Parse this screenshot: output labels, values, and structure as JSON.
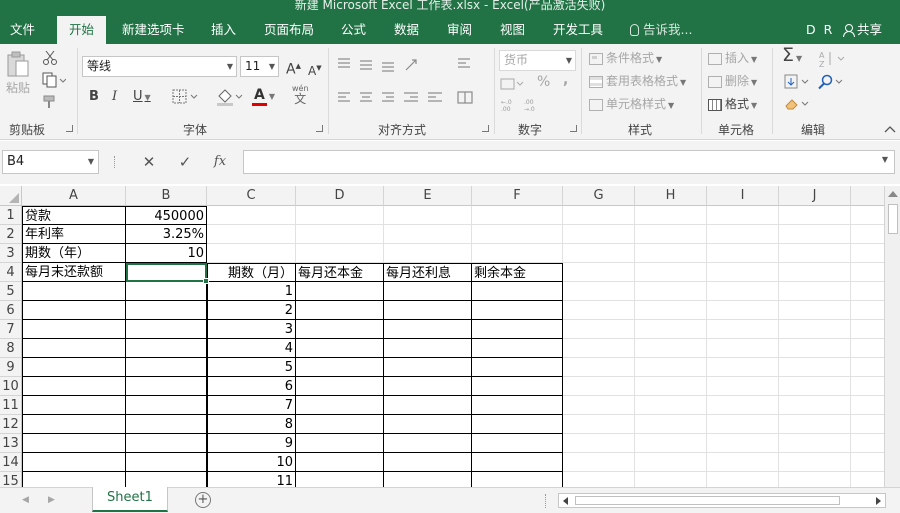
{
  "window": {
    "title": "新建 Microsoft Excel 工作表.xlsx - Excel(产品激活失败)"
  },
  "tabs": [
    {
      "label": "文件",
      "active": false
    },
    {
      "label": "开始",
      "active": true
    },
    {
      "label": "新建选项卡",
      "active": false
    },
    {
      "label": "插入",
      "active": false
    },
    {
      "label": "页面布局",
      "active": false
    },
    {
      "label": "公式",
      "active": false
    },
    {
      "label": "数据",
      "active": false
    },
    {
      "label": "审阅",
      "active": false
    },
    {
      "label": "视图",
      "active": false
    },
    {
      "label": "开发工具",
      "active": false
    }
  ],
  "tell_me": "告诉我...",
  "user_initials": "D R",
  "share_label": "共享",
  "ribbon": {
    "clipboard": {
      "label": "剪贴板",
      "paste": "粘贴"
    },
    "font": {
      "label": "字体",
      "font_name": "等线",
      "font_size": "11",
      "grow": "A",
      "shrink": "A",
      "bold": "B",
      "italic": "I",
      "underline": "U",
      "font_color": "A",
      "wen": "wén",
      "wen_char": "文"
    },
    "alignment": {
      "label": "对齐方式"
    },
    "number": {
      "label": "数字",
      "format": "货币",
      "percent": "%",
      "comma": ","
    },
    "styles": {
      "label": "样式",
      "conditional": "条件格式",
      "table": "套用表格格式",
      "cell_styles": "单元格样式"
    },
    "cells": {
      "label": "单元格",
      "insert": "插入",
      "delete": "删除",
      "format": "格式"
    },
    "editing": {
      "label": "编辑",
      "sum": "Σ"
    }
  },
  "formula_bar": {
    "name_box": "B4",
    "cancel": "✕",
    "enter": "✓",
    "fx": "fx",
    "value": ""
  },
  "columns": [
    "A",
    "B",
    "C",
    "D",
    "E",
    "F",
    "G",
    "H",
    "I",
    "J"
  ],
  "rows": [
    "1",
    "2",
    "3",
    "4",
    "5",
    "6",
    "7",
    "8",
    "9",
    "10",
    "11",
    "12",
    "13",
    "14",
    "15"
  ],
  "cells": {
    "A1": "贷款",
    "B1": "450000",
    "A2": "年利率",
    "B2": "3.25%",
    "A3": "期数（年）",
    "B3": "10",
    "A4": "每月末还款额",
    "B4": "",
    "C4": "期数（月）",
    "D4": "每月还本金",
    "E4": "每月还利息",
    "F4": "剩余本金",
    "C5": "1",
    "C6": "2",
    "C7": "3",
    "C8": "4",
    "C9": "5",
    "C10": "6",
    "C11": "7",
    "C12": "8",
    "C13": "9",
    "C14": "10",
    "C15": "11"
  },
  "sheets": [
    {
      "name": "Sheet1",
      "active": true
    }
  ],
  "add_sheet": "+",
  "colors": {
    "accent": "#217346",
    "ribbon_bg": "#f3f3f3",
    "gridline": "#e1e1e1"
  }
}
